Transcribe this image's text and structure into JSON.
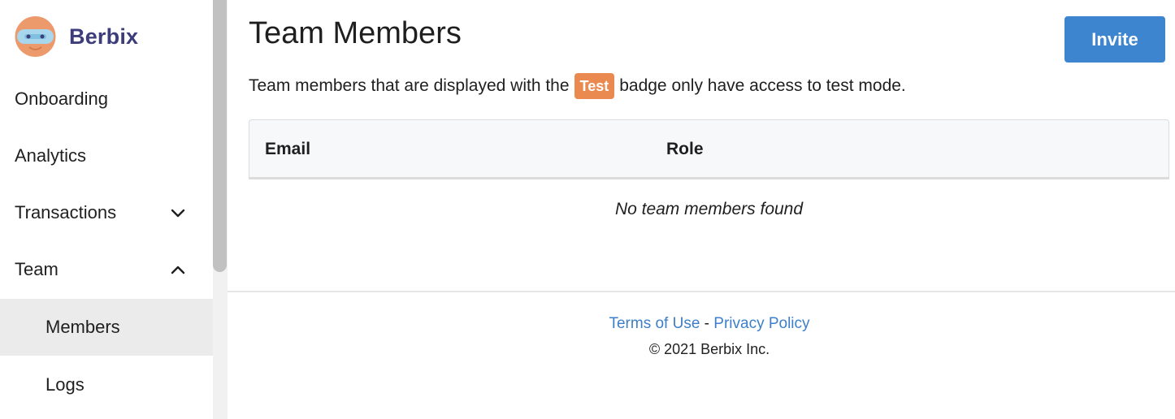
{
  "brand": {
    "name": "Berbix"
  },
  "sidebar": {
    "items": [
      {
        "label": "Onboarding"
      },
      {
        "label": "Analytics"
      },
      {
        "label": "Transactions",
        "expanded": false
      },
      {
        "label": "Team",
        "expanded": true
      },
      {
        "label": "Members",
        "active": true
      },
      {
        "label": "Logs"
      }
    ]
  },
  "main": {
    "title": "Team Members",
    "invite_label": "Invite",
    "description_before": "Team members that are displayed with the",
    "badge_label": "Test",
    "description_after": "badge only have access to test mode.",
    "table": {
      "columns": [
        "Email",
        "Role"
      ],
      "empty_message": "No team members found"
    }
  },
  "footer": {
    "terms_label": "Terms of Use",
    "separator": "-",
    "privacy_label": "Privacy Policy",
    "copyright": "© 2021 Berbix Inc."
  },
  "colors": {
    "accent": "#3d85cf",
    "brand_text": "#3c3d7a",
    "badge": "#ea8a50",
    "link": "#3d7fc8",
    "active_nav_bg": "#ebebeb"
  }
}
